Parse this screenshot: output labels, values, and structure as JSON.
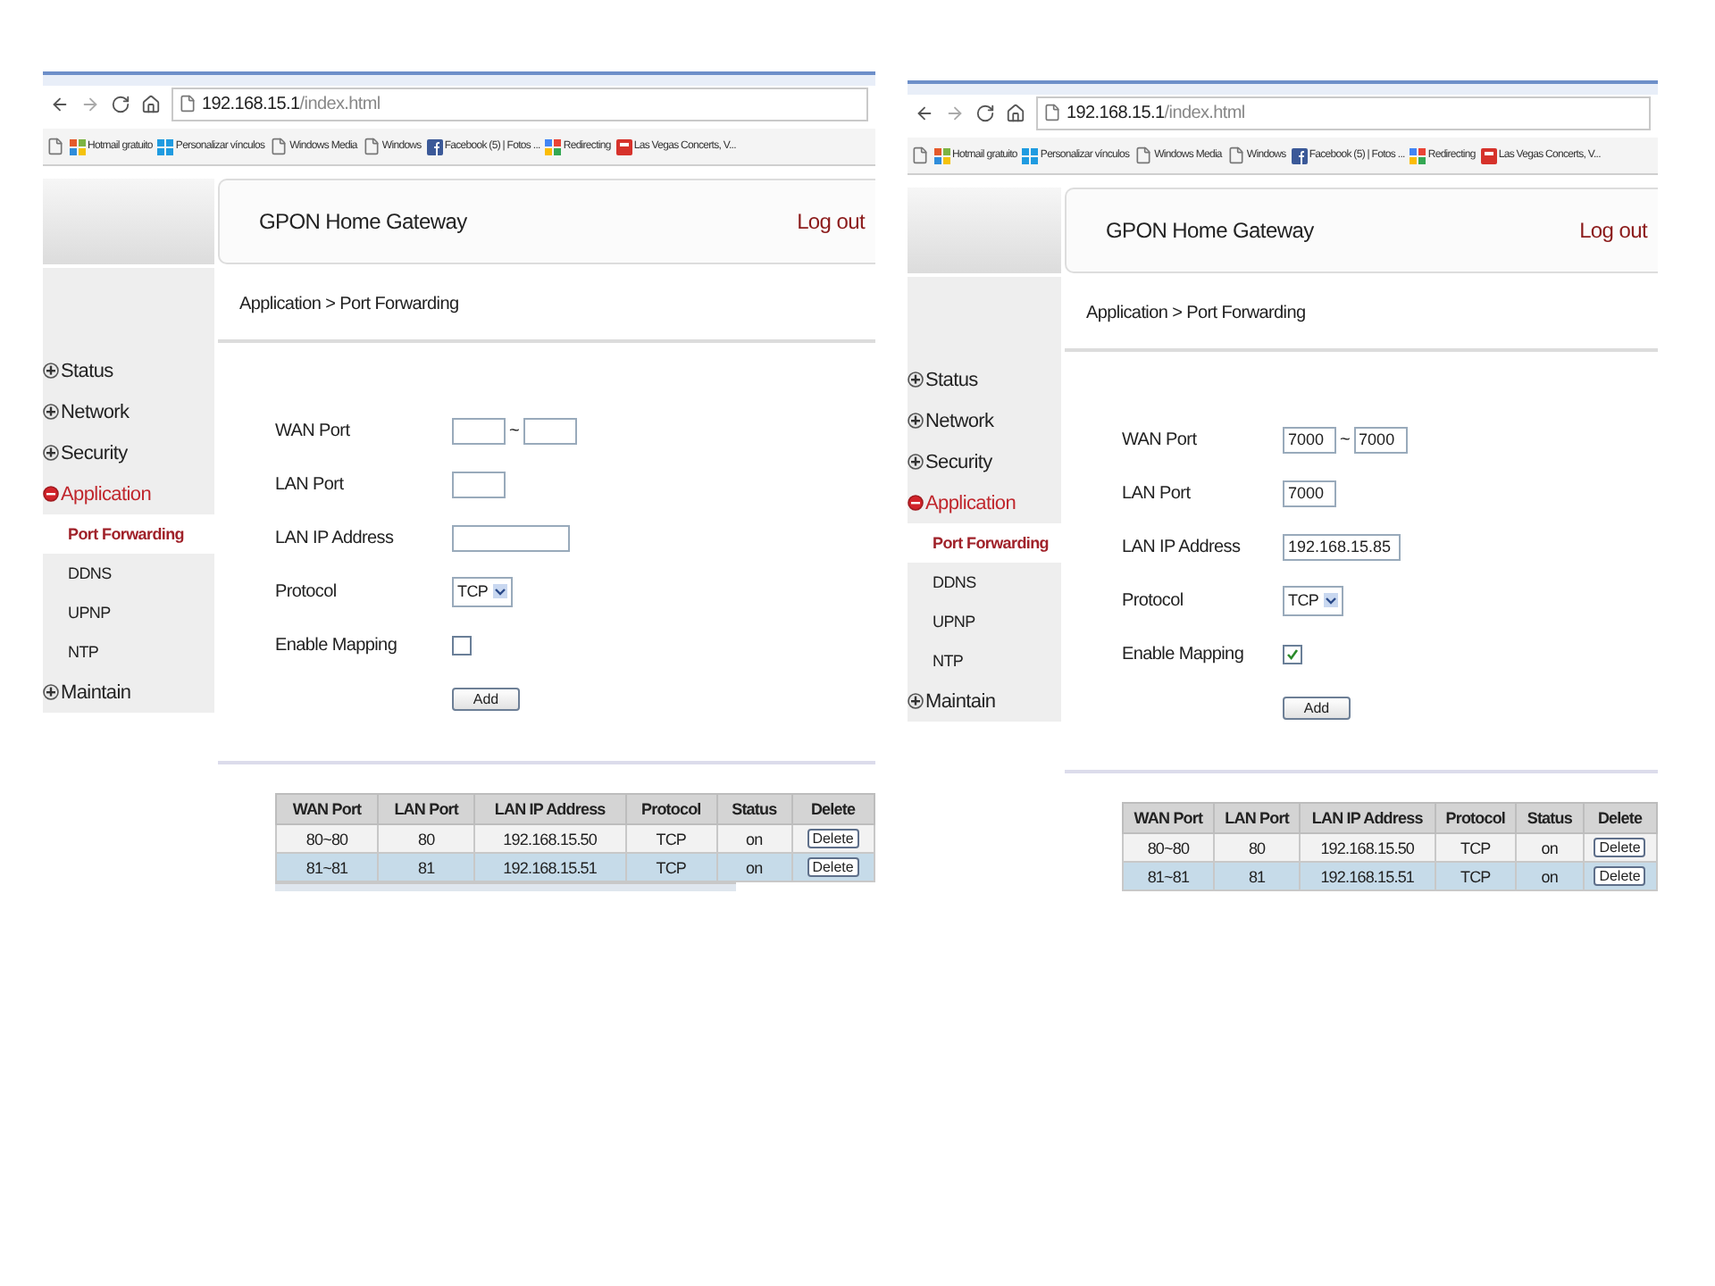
{
  "panels": [
    {
      "browser": {
        "url_host": "192.168.15.1",
        "url_path": "/index.html",
        "bookmarks": [
          {
            "kind": "page"
          },
          {
            "kind": "windows",
            "label": "Hotmail gratuito"
          },
          {
            "kind": "tiles",
            "label": "Personalizar vínculos"
          },
          {
            "kind": "page",
            "label": "Windows Media"
          },
          {
            "kind": "page",
            "label": "Windows"
          },
          {
            "kind": "facebook",
            "label": "Facebook (5) | Fotos ..."
          },
          {
            "kind": "google",
            "label": "Redirecting"
          },
          {
            "kind": "red",
            "label": "Las Vegas Concerts, V..."
          }
        ]
      },
      "header": {
        "title": "GPON Home Gateway",
        "logout": "Log out"
      },
      "breadcrumb": "Application > Port Forwarding",
      "sidebar": [
        {
          "label": "Status",
          "expanded": false
        },
        {
          "label": "Network",
          "expanded": false
        },
        {
          "label": "Security",
          "expanded": false
        },
        {
          "label": "Application",
          "expanded": true,
          "children": [
            {
              "label": "Port Forwarding",
              "selected": true
            },
            {
              "label": "DDNS",
              "selected": false
            },
            {
              "label": "UPNP",
              "selected": false
            },
            {
              "label": "NTP",
              "selected": false
            }
          ]
        },
        {
          "label": "Maintain",
          "expanded": false
        }
      ],
      "form": {
        "fields": [
          {
            "kind": "range",
            "label": "WAN Port",
            "separator": "~"
          },
          {
            "kind": "text",
            "label": "LAN Port"
          },
          {
            "kind": "ip",
            "label": "LAN IP Address"
          },
          {
            "kind": "select",
            "label": "Protocol",
            "value": "TCP"
          },
          {
            "kind": "checkbox",
            "label": "Enable Mapping",
            "checked": false
          }
        ],
        "button": "Add"
      },
      "table": {
        "columns": [
          "WAN Port",
          "LAN Port",
          "LAN IP Address",
          "Protocol",
          "Status",
          "Delete"
        ],
        "rows": [
          {
            "cells": [
              "80~80",
              "80",
              "192.168.15.50",
              "TCP",
              "on"
            ],
            "action": "Delete",
            "selected": false
          },
          {
            "cells": [
              "81~81",
              "81",
              "192.168.15.51",
              "TCP",
              "on"
            ],
            "action": "Delete",
            "selected": true
          }
        ],
        "more_rows": true
      }
    },
    {
      "browser": {
        "url_host": "192.168.15.1",
        "url_path": "/index.html",
        "bookmarks": [
          {
            "kind": "page"
          },
          {
            "kind": "windows",
            "label": "Hotmail gratuito"
          },
          {
            "kind": "tiles",
            "label": "Personalizar vínculos"
          },
          {
            "kind": "page",
            "label": "Windows Media"
          },
          {
            "kind": "page",
            "label": "Windows"
          },
          {
            "kind": "facebook",
            "label": "Facebook (5) | Fotos ..."
          },
          {
            "kind": "google",
            "label": "Redirecting"
          },
          {
            "kind": "red",
            "label": "Las Vegas Concerts, V..."
          }
        ]
      },
      "header": {
        "title": "GPON Home Gateway",
        "logout": "Log out"
      },
      "breadcrumb": "Application > Port Forwarding",
      "sidebar": [
        {
          "label": "Status",
          "expanded": false
        },
        {
          "label": "Network",
          "expanded": false
        },
        {
          "label": "Security",
          "expanded": false
        },
        {
          "label": "Application",
          "expanded": true,
          "children": [
            {
              "label": "Port Forwarding",
              "selected": true
            },
            {
              "label": "DDNS",
              "selected": false
            },
            {
              "label": "UPNP",
              "selected": false
            },
            {
              "label": "NTP",
              "selected": false
            }
          ]
        },
        {
          "label": "Maintain",
          "expanded": false
        }
      ],
      "form": {
        "fields": [
          {
            "kind": "range",
            "label": "WAN Port",
            "separator": "~",
            "from": "7000",
            "to": "7000"
          },
          {
            "kind": "text",
            "label": "LAN Port",
            "value": "7000"
          },
          {
            "kind": "ip",
            "label": "LAN IP Address",
            "value": "192.168.15.85"
          },
          {
            "kind": "select",
            "label": "Protocol",
            "value": "TCP"
          },
          {
            "kind": "checkbox",
            "label": "Enable Mapping",
            "checked": true
          }
        ],
        "button": "Add"
      },
      "table": {
        "columns": [
          "WAN Port",
          "LAN Port",
          "LAN IP Address",
          "Protocol",
          "Status",
          "Delete"
        ],
        "rows": [
          {
            "cells": [
              "80~80",
              "80",
              "192.168.15.50",
              "TCP",
              "on"
            ],
            "action": "Delete",
            "selected": false
          },
          {
            "cells": [
              "81~81",
              "81",
              "192.168.15.51",
              "TCP",
              "on"
            ],
            "action": "Delete",
            "selected": true
          }
        ],
        "more_rows": false
      }
    }
  ]
}
